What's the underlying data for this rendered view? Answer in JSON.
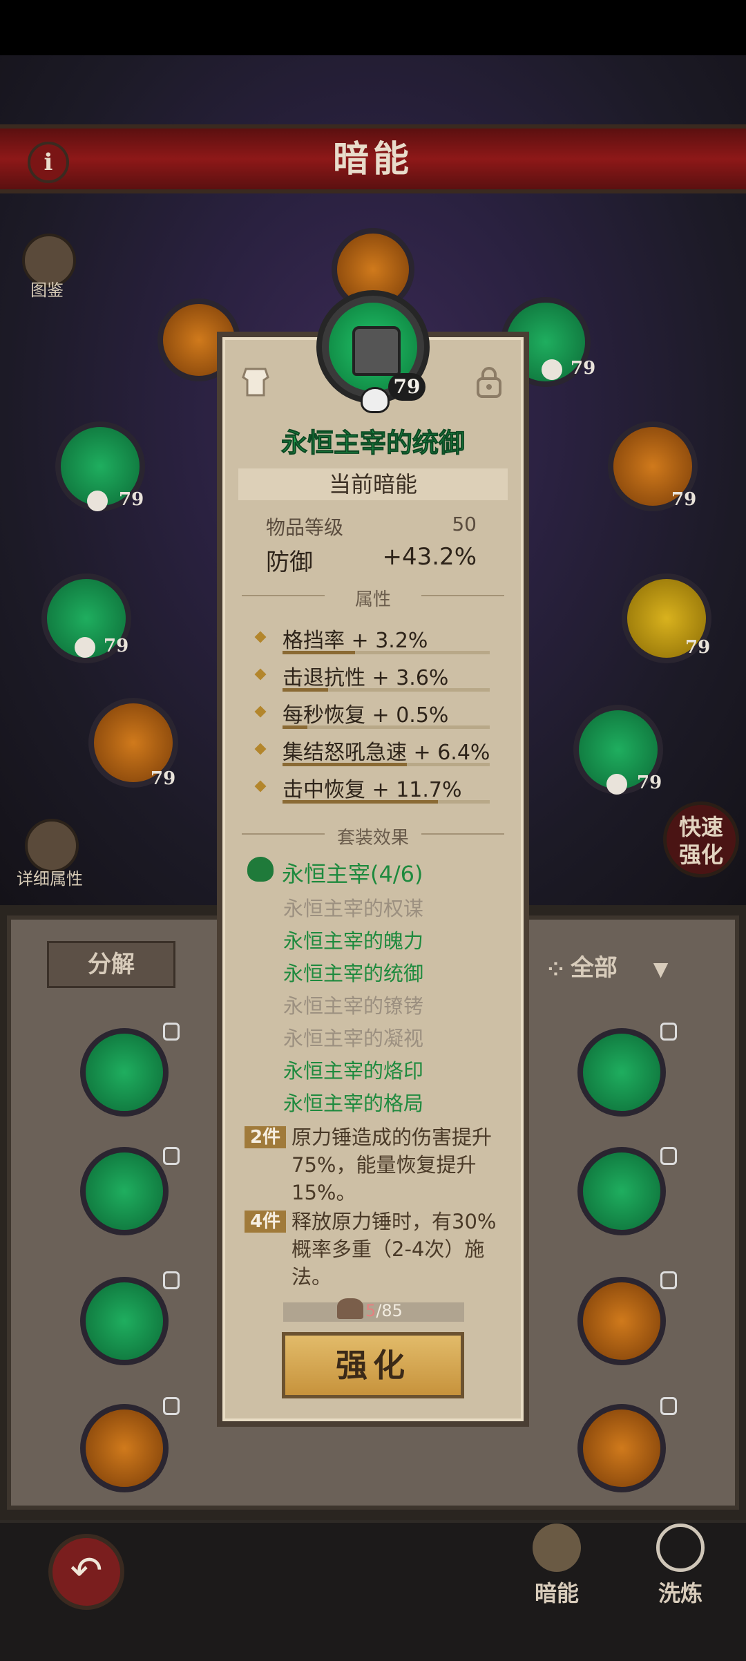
{
  "window": {
    "title": "暗能"
  },
  "side": {
    "codex_label": "图鉴",
    "details_label": "详细属性",
    "quick_upgrade_line1": "快速",
    "quick_upgrade_line2": "强化"
  },
  "equip_levels": [
    "79",
    "79",
    "79",
    "79",
    "79",
    "79",
    "79",
    "79",
    "79"
  ],
  "inventory": {
    "salvage_label": "分解",
    "filter_label": "全部"
  },
  "nav": {
    "tab_dark_energy": "暗能",
    "tab_refine": "洗炼"
  },
  "item": {
    "level_badge": "79",
    "name": "永恒主宰的统御",
    "section_current": "当前暗能",
    "item_level_label": "物品等级",
    "item_level_value": "50",
    "main_stat_label": "防御",
    "main_stat_value": "+43.2%",
    "attributes_header": "属性",
    "attributes": [
      {
        "text": "格挡率 + 3.2%",
        "fill": 0.35
      },
      {
        "text": "击退抗性 + 3.6%",
        "fill": 0.22
      },
      {
        "text": "每秒恢复 + 0.5%",
        "fill": 0.12
      },
      {
        "text": "集结怒吼急速 + 6.4%",
        "fill": 0.6
      },
      {
        "text": "击中恢复 + 11.7%",
        "fill": 0.75
      }
    ],
    "set_header": "套装效果",
    "set_title": "永恒主宰(4/6)",
    "set_pieces": [
      {
        "name": "永恒主宰的权谋",
        "owned": false
      },
      {
        "name": "永恒主宰的魄力",
        "owned": true
      },
      {
        "name": "永恒主宰的统御",
        "owned": true
      },
      {
        "name": "永恒主宰的镣铐",
        "owned": false
      },
      {
        "name": "永恒主宰的凝视",
        "owned": false
      },
      {
        "name": "永恒主宰的烙印",
        "owned": true
      },
      {
        "name": "永恒主宰的格局",
        "owned": true
      }
    ],
    "bonus_2_tag": "2件",
    "bonus_2_text": "原力锤造成的伤害提升75%，能量恢复提升15%。",
    "bonus_4_tag": "4件",
    "bonus_4_text": "释放原力锤时，有30%概率多重（2-4次）施法。",
    "cost_current": "5",
    "cost_total": "/85",
    "upgrade_label": "强化"
  },
  "colors": {
    "accent_green": "#1e8a3e",
    "banner_red": "#8e1818",
    "button_gold": "#d4a552"
  }
}
